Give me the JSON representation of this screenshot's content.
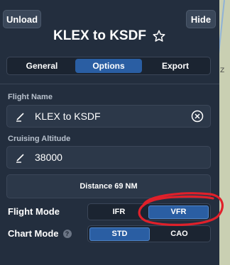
{
  "header": {
    "unload_label": "Unload",
    "hide_label": "Hide",
    "title": "KLEX to KSDF"
  },
  "tabs": [
    {
      "label": "General",
      "active": false
    },
    {
      "label": "Options",
      "active": true
    },
    {
      "label": "Export",
      "active": false
    }
  ],
  "flight_name": {
    "label": "Flight Name",
    "value": "KLEX to KSDF"
  },
  "cruising_altitude": {
    "label": "Cruising Altitude",
    "value": "38000"
  },
  "distance": {
    "text": "Distance 69 NM"
  },
  "flight_mode": {
    "label": "Flight Mode",
    "options": [
      "IFR",
      "VFR"
    ],
    "selected": "VFR"
  },
  "chart_mode": {
    "label": "Chart Mode",
    "options": [
      "STD",
      "CAO"
    ],
    "selected": "STD"
  },
  "colors": {
    "panel": "#232e3e",
    "accent": "#2a5ea3",
    "annotation": "#e0202a"
  },
  "icons": [
    "star-icon",
    "pencil-icon",
    "clear-icon",
    "help-icon"
  ]
}
